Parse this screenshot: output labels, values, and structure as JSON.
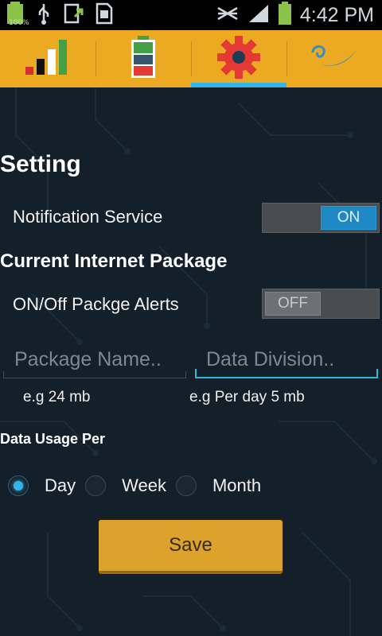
{
  "status_bar": {
    "battery_percent": "100%",
    "time": "4:42 PM"
  },
  "tabs": [
    {
      "id": "signal",
      "icon": "signal-bars-icon"
    },
    {
      "id": "battery",
      "icon": "battery-icon"
    },
    {
      "id": "settings",
      "icon": "gear-icon",
      "active": true
    },
    {
      "id": "wave",
      "icon": "wave-logo-icon"
    }
  ],
  "settings": {
    "title": "Setting",
    "notification_label": "Notification Service",
    "notification_toggle": "ON",
    "package_section": "Current Internet Package",
    "package_alerts_label": "ON/Off Packge Alerts",
    "package_alerts_toggle": "OFF",
    "package_name_placeholder": "Package Name..",
    "data_division_placeholder": "Data Division..",
    "package_hint": "e.g 24 mb",
    "division_hint": "e.g Per day 5 mb",
    "usage_label": "Data Usage Per",
    "usage_options": [
      {
        "label": "Day",
        "checked": true
      },
      {
        "label": "Week",
        "checked": false
      },
      {
        "label": "Month",
        "checked": false
      }
    ],
    "save_label": "Save"
  },
  "colors": {
    "accent": "#33b5e5",
    "tab_bar": "#ecaa23",
    "background": "#13202a",
    "button": "#dca22b"
  }
}
